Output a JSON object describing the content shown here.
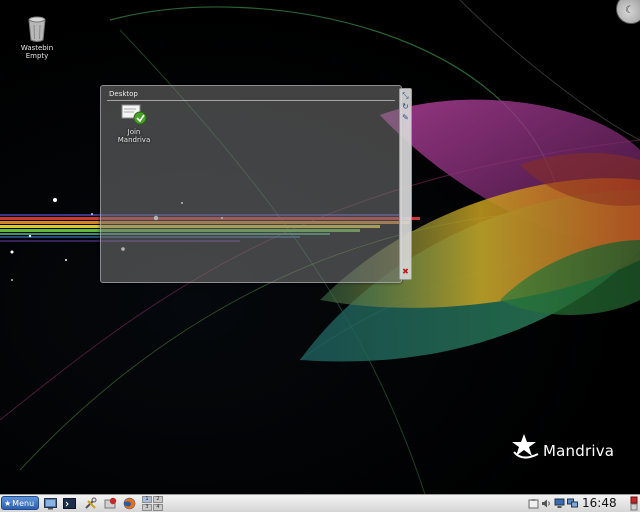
{
  "desktop": {
    "trash": {
      "label_line1": "Wastebin",
      "label_line2": "Empty",
      "icon": "trash-can-icon"
    }
  },
  "folder_view": {
    "title": "Desktop",
    "items": [
      {
        "label_line1": "Join",
        "label_line2": "Mandriva",
        "icon": "join-mandriva-document-icon"
      }
    ],
    "handle_buttons": [
      "resize-icon",
      "rotate-icon",
      "configure-icon",
      "close-icon"
    ]
  },
  "logo": {
    "text": "Mandriva"
  },
  "taskbar": {
    "menu_label": "Menu",
    "launchers": [
      "show-desktop-icon",
      "terminal-icon",
      "system-tools-icon",
      "software-update-icon",
      "firefox-icon"
    ],
    "pager": [
      "1",
      "2",
      "3",
      "4"
    ],
    "tray_icons": [
      "clipboard-icon",
      "volume-icon",
      "network-icon",
      "display-icon",
      "updates-icon"
    ],
    "clock": "16:48"
  },
  "colors": {
    "taskbar_bg": "#e4e4e4",
    "menu_button": "#3d70c0",
    "close_red": "#c01818"
  }
}
